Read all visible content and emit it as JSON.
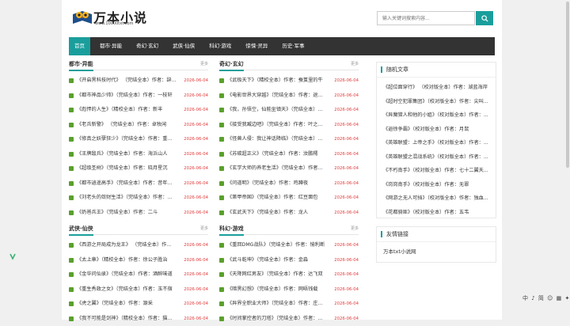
{
  "site": {
    "title": "万本小说",
    "url": "www.10000txt.com"
  },
  "search": {
    "placeholder": "输入关键词搜索内容..."
  },
  "nav": [
    "首页",
    "都市·异能",
    "奇幻·玄幻",
    "武侠·仙侠",
    "科幻·游戏",
    "惊悚·灵异",
    "历史·军事"
  ],
  "more_label": "更多",
  "sections": [
    {
      "title": "都市·异能",
      "rows": [
        [
          "《开启黑科技时代》 （完结全本）作者：辞...",
          "2026-06-04"
        ],
        [
          "《都市神品少帅》（完结全本）作者：一枝轩",
          "2026-06-04"
        ],
        [
          "《彪悍的人生》（精校全本）作者：新丰",
          "2026-06-04"
        ],
        [
          "《老兵新警》 （完结全本）作者：卓牧闲",
          "2026-06-04"
        ],
        [
          "《修真之妖孽狂少》（完结全本）作者：重...",
          "2026-06-04"
        ],
        [
          "《王牌敌兵》（完结全本）作者：海浜山人",
          "2026-06-04"
        ],
        [
          "《超级圣树》（完结全本）作者：晓月星沉",
          "2026-06-04"
        ],
        [
          "《都市逍遥高手》（完结全本）作者：昔年...",
          "2026-06-04"
        ],
        [
          "《刘老头的敛财生活》（完结全本）作者：...",
          "2026-06-04"
        ],
        [
          "《奶爸兵王》（完结全本）作者：二斗",
          "2026-06-04"
        ]
      ]
    },
    {
      "title": "奇幻·玄幻",
      "rows": [
        [
          "《武极天下》（精校全本）作者：蚕茧里的牛",
          "2026-06-04"
        ],
        [
          "《电影世界大穿越》（完结全本）作者：退...",
          "2026-06-04"
        ],
        [
          "《我，孙悟空，仙能坐镇天》（完结全本）...",
          "2026-06-04"
        ],
        [
          "《接受我臧边吧》（完结全本）作者：叶之...",
          "2026-06-04"
        ],
        [
          "《怪兽人侵：我让神话降临》（完结全本）...",
          "2026-06-04"
        ],
        [
          "《苏碳超正义》（完结全本）作者：汝鹏樗",
          "2026-06-04"
        ],
        [
          "《玄学大师的养老生活》（完结全本）作者...",
          "2026-06-04"
        ],
        [
          "《问道明》（完结全本）作者：鸡蹲夜",
          "2026-06-04"
        ],
        [
          "《第甲帝国》（完结全本）作者：红豆面包",
          "2026-06-04"
        ],
        [
          "《玄武天下》（完结全本）作者：龙人",
          "2026-06-04"
        ]
      ]
    },
    {
      "title": "武侠·仙侠",
      "rows": [
        [
          "《西游之开局成为龙王》 （完结全本）作...",
          "2026-06-04"
        ],
        [
          "《太上章》（精校全本）作者：徐公子胜治",
          "2026-06-04"
        ],
        [
          "《金华问仙录》（完结全本）作者：酒醉味道",
          "2026-06-04"
        ],
        [
          "《重生秀政之女》（完结全本）作者：玉不宿",
          "2026-06-04"
        ],
        [
          "《虎之翼》（完结全本）作者：源采",
          "2026-06-04"
        ],
        [
          "《我不可能是剑神》（精校全本）作者：猫...",
          "2026-06-04"
        ]
      ]
    },
    {
      "title": "科幻·游戏",
      "rows": [
        [
          "《重回DMG战队》（完结全本）作者：愉利断",
          "2026-06-04"
        ],
        [
          "《武斗乾坤》（完结全本）作者：金淼",
          "2026-06-04"
        ],
        [
          "《天降网红男友》（完结全本）作者：达飞双",
          "2026-06-04"
        ],
        [
          "《暗黑幻想》（完结全本）作者：网唔钱载",
          "2026-06-04"
        ],
        [
          "《异界全职业大师》（完结全本）作者：庄...",
          "2026-06-04"
        ],
        [
          "《时间掌控者的刀塔》（完结全本）作者：...",
          "2026-06-04"
        ]
      ]
    }
  ],
  "sidebar": {
    "random_title": "随机文章",
    "random": [
      "《超位面穿行》 （校对版全本）作者：湖蓝海岸",
      "《超时空犯罪集团》（校对版全本）作者：尖叫...",
      "《异魔猎人和他的小姐》（校对版全本）作者：...",
      "《逍徐争霸》（校对版全本）作者：月鼠",
      "《英雄联盟：上帝之手》（校对版全本）作者：...",
      "《英雄联盟之混战系统》（校对版全本）作者：...",
      "《不朽南手》（校对版全本）作者：七十二翼天...",
      "《岗岗南手》（校对版全本）作者：无罪",
      "《网游之无人可挡》（校对版全本）作者：独血...",
      "《花都骑匪》（校对版全本）作者：五韦"
    ],
    "links_title": "友情链接",
    "links": [
      "万本txt小说网"
    ]
  },
  "ime_bar": "中 ♪ 简 ☺ ▦ ✦ ▤",
  "colors": {
    "accent": "#1a9e9c",
    "nav_bg": "#333333",
    "date": "#e23b3b",
    "tag": "#5aa02c"
  }
}
